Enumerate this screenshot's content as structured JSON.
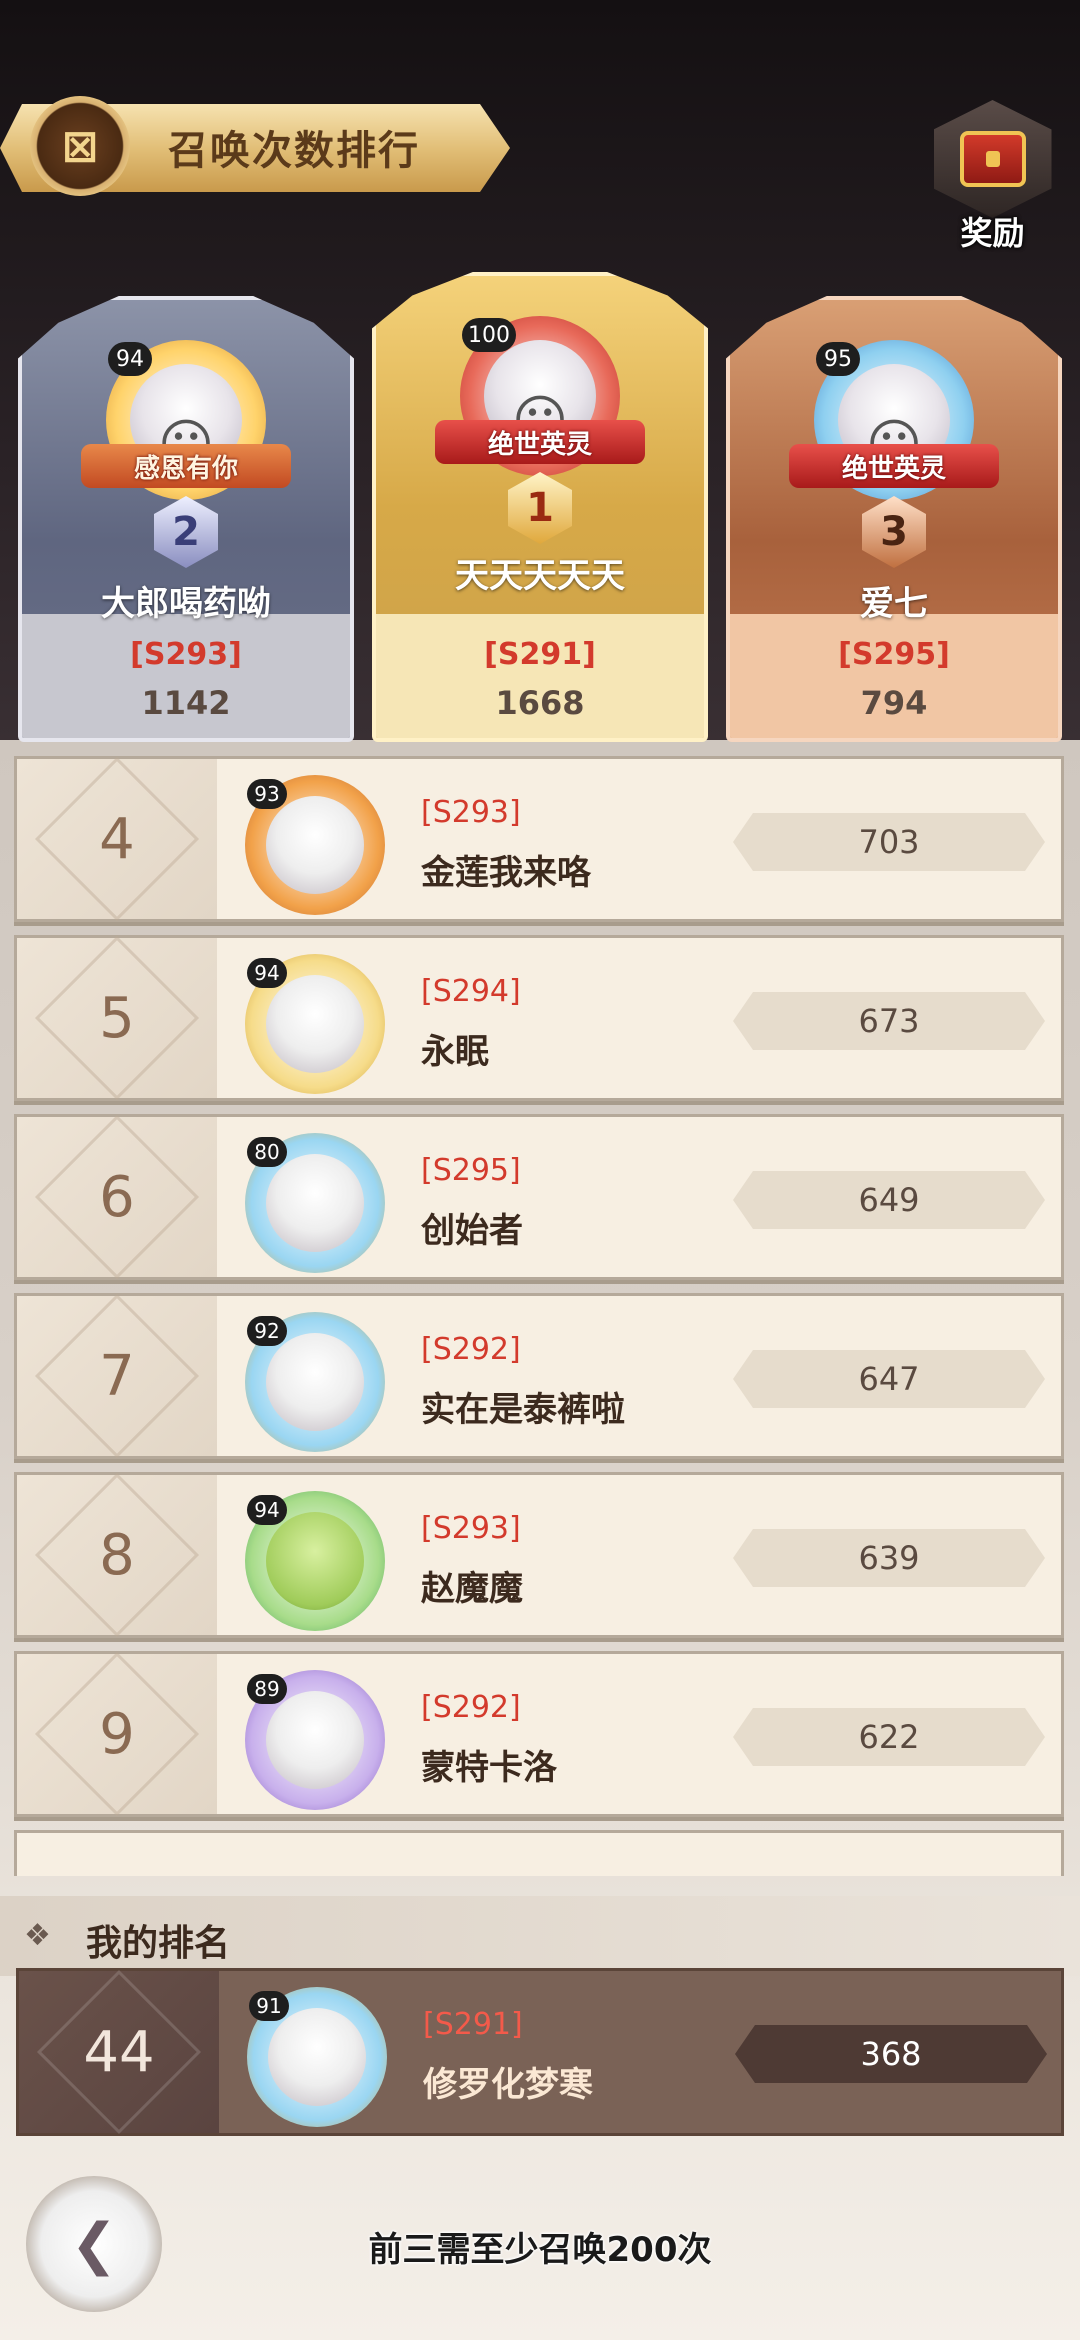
{
  "header": {
    "title": "召唤次数排行",
    "title_icon": "medal-icon",
    "reward_label": "奖励",
    "reward_icon": "treasure-chest-icon"
  },
  "podium": [
    {
      "rank": "2",
      "level": "94",
      "title_badge": "感恩有你",
      "name": "大郎喝药呦",
      "server": "[S293]",
      "count": "1142"
    },
    {
      "rank": "1",
      "level": "100",
      "title_badge": "绝世英灵",
      "name": "天天天天天",
      "server": "[S291]",
      "count": "1668"
    },
    {
      "rank": "3",
      "level": "95",
      "title_badge": "绝世英灵",
      "name": "爱七",
      "server": "[S295]",
      "count": "794"
    }
  ],
  "rows": [
    {
      "rank": "4",
      "level": "93",
      "server": "[S293]",
      "name": "金莲我来咯",
      "count": "703"
    },
    {
      "rank": "5",
      "level": "94",
      "server": "[S294]",
      "name": "永眠",
      "count": "673"
    },
    {
      "rank": "6",
      "level": "80",
      "server": "[S295]",
      "name": "创始者",
      "count": "649"
    },
    {
      "rank": "7",
      "level": "92",
      "server": "[S292]",
      "name": "实在是泰裤啦",
      "count": "647"
    },
    {
      "rank": "8",
      "level": "94",
      "server": "[S293]",
      "name": "赵魔魔",
      "count": "639"
    },
    {
      "rank": "9",
      "level": "89",
      "server": "[S292]",
      "name": "蒙特卡洛",
      "count": "622"
    }
  ],
  "my_rank": {
    "header": "我的排名",
    "rank": "44",
    "level": "91",
    "server": "[S291]",
    "name": "修罗化梦寒",
    "count": "368"
  },
  "footer": {
    "back_icon": "back-arrow-icon",
    "hint": "前三需至少召唤200次"
  }
}
